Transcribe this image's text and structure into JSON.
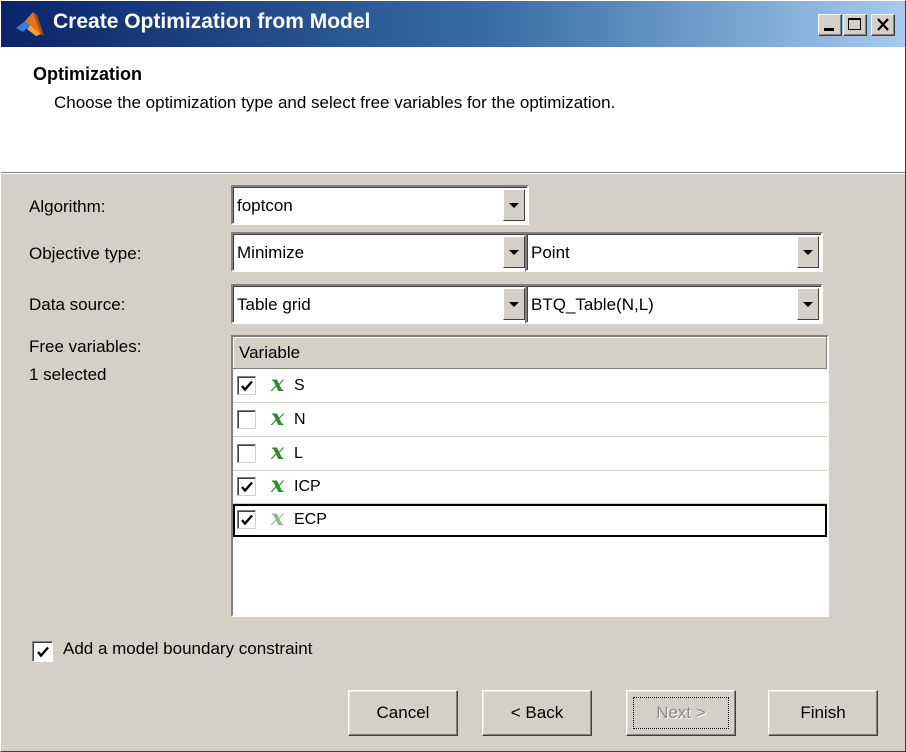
{
  "window": {
    "title": "Create Optimization from Model",
    "controls": [
      "minimize-icon",
      "maximize-icon",
      "close-icon"
    ]
  },
  "header": {
    "title": "Optimization",
    "description": "Choose the optimization type and select free variables for the optimization."
  },
  "form": {
    "algorithm_label": "Algorithm:",
    "algorithm_value": "foptcon",
    "objective_label": "Objective type:",
    "objective_value": "Minimize",
    "objective_mode": "Point",
    "datasource_label": "Data source:",
    "datasource_value": "Table grid",
    "datasource_table": "BTQ_Table(N,L)",
    "free_vars_label": "Free variables:",
    "free_vars_count": "1 selected"
  },
  "table": {
    "column": "Variable",
    "icon_glyph": "x",
    "rows": [
      {
        "name": "S",
        "checked": true
      },
      {
        "name": "N",
        "checked": false
      },
      {
        "name": "L",
        "checked": false
      },
      {
        "name": "ICP",
        "checked": true
      },
      {
        "name": "ECP",
        "checked": true,
        "selected": true
      }
    ]
  },
  "boundary": {
    "label": "Add a model boundary constraint",
    "checked": true
  },
  "buttons": {
    "cancel": "Cancel",
    "back": "< Back",
    "next": "Next >",
    "finish": "Finish"
  },
  "colors": {
    "titlebar_start": "#0a246a",
    "titlebar_end": "#a6caf0",
    "dialog_bg": "#d4d0c8",
    "variable_icon": "#2e8b2e"
  }
}
